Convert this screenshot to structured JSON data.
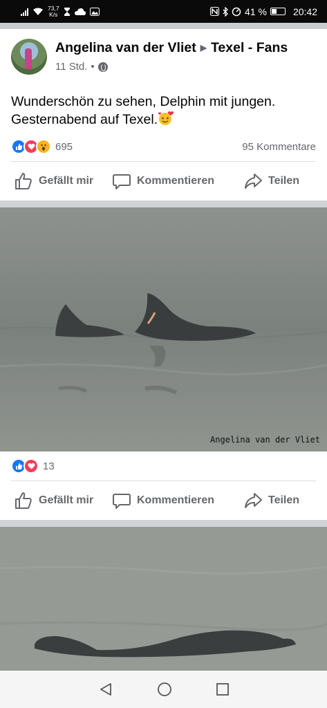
{
  "status_bar": {
    "speed_value": "73,7",
    "speed_unit": "K/s",
    "battery_percent": "41 %",
    "time": "20:42"
  },
  "post": {
    "author": "Angelina van der Vliet",
    "group": "Texel - Fans",
    "time_ago": "11 Std.",
    "separator": "•",
    "text_line1": "Wunderschön zu sehen, Delphin mit jungen.",
    "text_line2": "Gesternabend auf Texel.",
    "reaction_count": "695",
    "comment_count": "95 Kommentare",
    "actions": {
      "like": "Gefällt mir",
      "comment": "Kommentieren",
      "share": "Teilen"
    }
  },
  "photo1": {
    "watermark": "Angelina van der Vliet",
    "reaction_count": "13",
    "actions": {
      "like": "Gefällt mir",
      "comment": "Kommentieren",
      "share": "Teilen"
    }
  },
  "colors": {
    "like_blue": "#1877f2",
    "love_red": "#f33e58",
    "wow_yellow": "#f7b125",
    "text_gray": "#65676b"
  }
}
